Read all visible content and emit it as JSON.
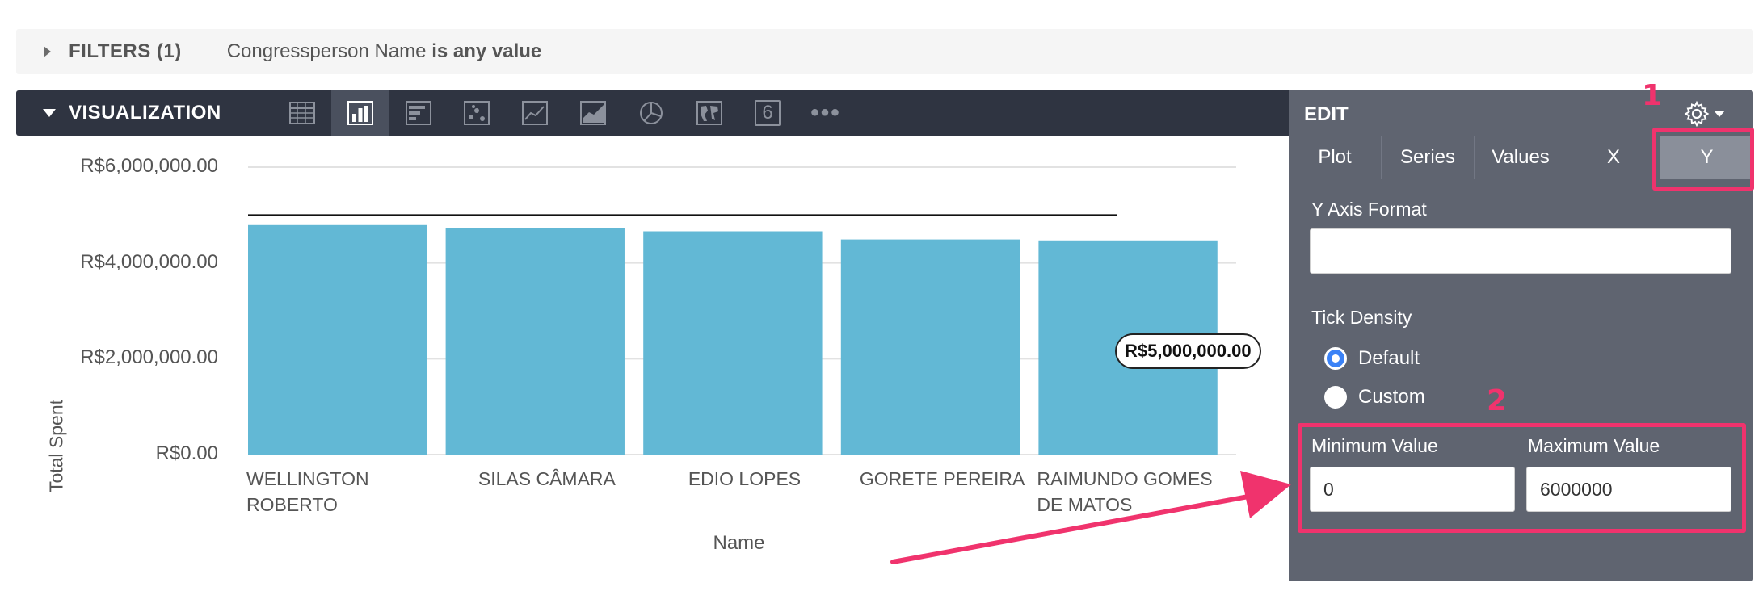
{
  "filters": {
    "label": "FILTERS (1)",
    "field": "Congressperson Name",
    "condition": "is any value"
  },
  "visualization": {
    "label": "VISUALIZATION",
    "icons": [
      "table-icon",
      "column-chart-icon",
      "bar-chart-icon",
      "scatter-icon",
      "line-chart-icon",
      "area-chart-icon",
      "pie-chart-icon",
      "map-icon",
      "single-value-icon",
      "more-icon"
    ],
    "active_icon": "column-chart-icon",
    "single_value_glyph": "6",
    "more_glyph": "•••"
  },
  "chart_data": {
    "type": "bar",
    "categories": [
      "WELLINGTON ROBERTO",
      "SILAS CÂMARA",
      "EDIO LOPES",
      "GORETE PEREIRA",
      "RAIMUNDO GOMES DE MATOS"
    ],
    "category_lines": [
      [
        "WELLINGTON",
        "ROBERTO"
      ],
      [
        "SILAS CÂMARA"
      ],
      [
        "EDIO LOPES"
      ],
      [
        "GORETE PEREIRA"
      ],
      [
        "RAIMUNDO GOMES",
        "DE MATOS"
      ]
    ],
    "values": [
      4790000,
      4730000,
      4660000,
      4490000,
      4470000
    ],
    "xlabel": "Name",
    "ylabel": "Total Spent",
    "ylim": [
      0,
      6000000
    ],
    "yticks": [
      0,
      2000000,
      4000000,
      6000000
    ],
    "ytick_labels": [
      "R$0.00",
      "R$2,000,000.00",
      "R$4,000,000.00",
      "R$6,000,000.00"
    ],
    "reference_line": {
      "value": 5000000,
      "label": "R$5,000,000.00"
    },
    "bar_color": "#62b8d5",
    "grid": true
  },
  "edit_panel": {
    "title": "EDIT",
    "tabs": [
      "Plot",
      "Series",
      "Values",
      "X",
      "Y"
    ],
    "active_tab": "Y",
    "y_axis_format_label": "Y Axis Format",
    "y_axis_format_value": "",
    "tick_density_label": "Tick Density",
    "tick_density_options": [
      "Default",
      "Custom"
    ],
    "tick_density_selected": "Default",
    "min_label": "Minimum Value",
    "min_value": "0",
    "max_label": "Maximum Value",
    "max_value": "6000000"
  },
  "annotations": {
    "one": "1",
    "two": "2",
    "color": "#f0336d"
  }
}
